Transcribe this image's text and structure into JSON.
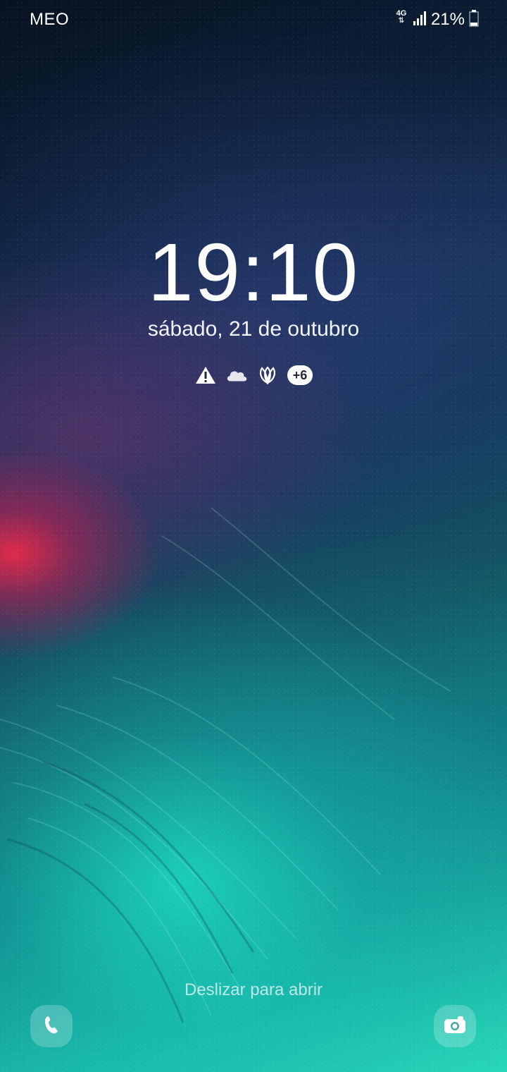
{
  "status_bar": {
    "carrier": "MEO",
    "network_type": "4G",
    "network_icon": "4g-data-icon",
    "signal_icon": "signal-bars-icon",
    "battery_percent": "21%",
    "battery_icon": "battery-icon",
    "battery_level": 0.21
  },
  "lock_screen": {
    "time": "19:10",
    "date": "sábado, 21 de outubro",
    "notification_icons": [
      "warning-icon",
      "cloud-icon",
      "flower-icon"
    ],
    "more_notifications": "+6",
    "swipe_hint": "Deslizar para abrir"
  },
  "shortcuts": {
    "left": "phone-icon",
    "right": "camera-icon"
  },
  "colors": {
    "text": "#ffffff",
    "badge_bg": "#ffffff",
    "badge_text": "#222a33",
    "wallpaper_top": "#071220",
    "wallpaper_bottom": "#28d6b8",
    "wallpaper_accent": "#ff2846"
  }
}
